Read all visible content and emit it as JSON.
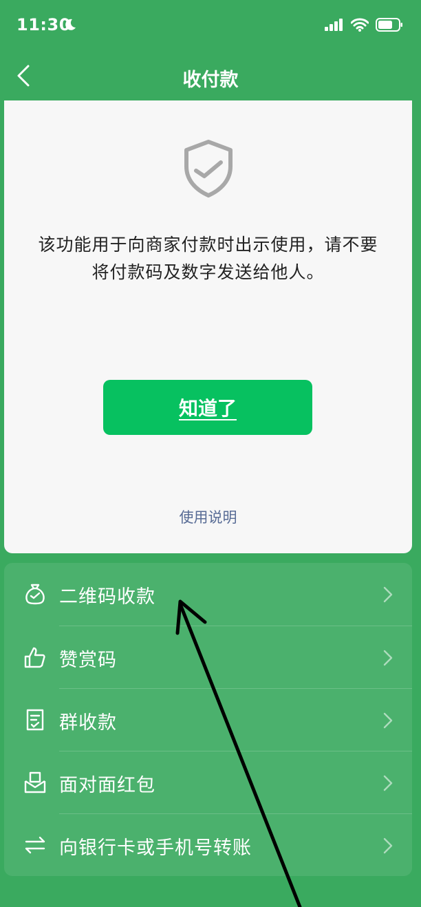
{
  "status_bar": {
    "time": "11:30"
  },
  "nav": {
    "title": "收付款"
  },
  "card": {
    "message": "该功能用于向商家付款时出示使用，请不要将付款码及数字发送给他人。",
    "ok_button": "知道了",
    "help_link": "使用说明"
  },
  "menu": {
    "items": [
      {
        "label": "二维码收款",
        "icon": "money-bag-icon"
      },
      {
        "label": "赞赏码",
        "icon": "thumbs-up-icon"
      },
      {
        "label": "群收款",
        "icon": "group-bill-icon"
      },
      {
        "label": "面对面红包",
        "icon": "red-packet-icon"
      },
      {
        "label": "向银行卡或手机号转账",
        "icon": "transfer-arrows-icon"
      }
    ]
  },
  "colors": {
    "background": "#3aaa5f",
    "button_green": "#07c160",
    "link_blue": "#576b95",
    "card": "#f7f7f7"
  }
}
